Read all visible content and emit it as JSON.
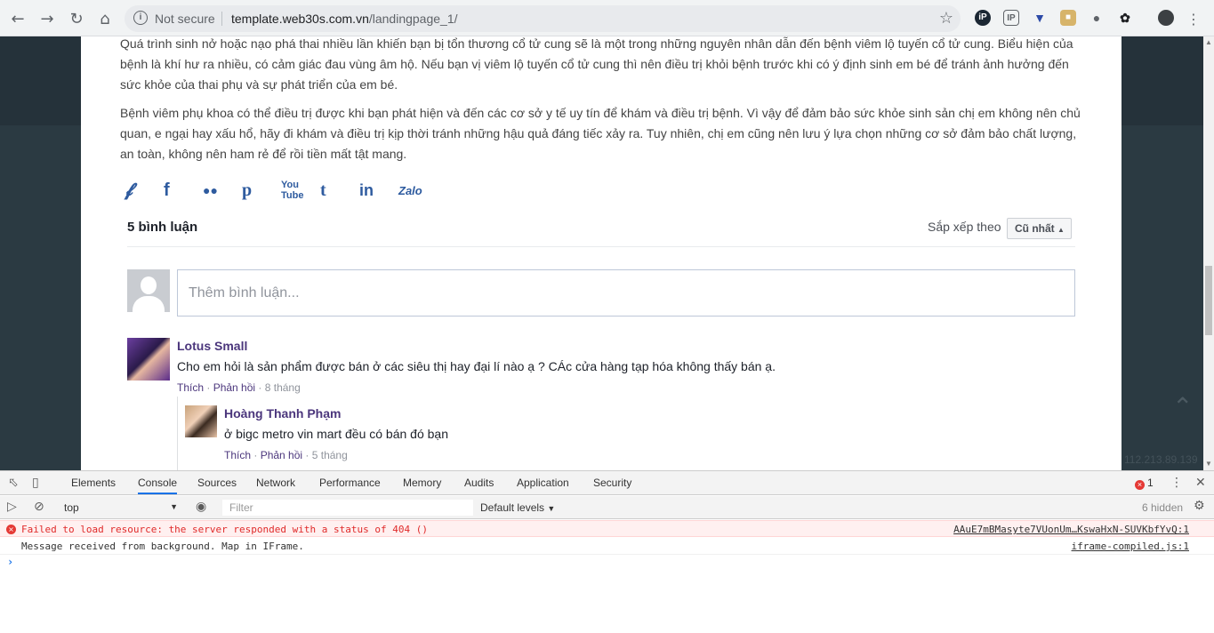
{
  "browser": {
    "security_label": "Not secure",
    "url_host": "template.web30s.com.vn",
    "url_path": "/landingpage_1/"
  },
  "article": {
    "paragraph1": "Quá trình sinh nở hoặc nạo phá thai nhiều lần khiến bạn bị tổn thương cổ tử cung sẽ là một trong những nguyên nhân dẫn đến bệnh viêm lộ tuyến cổ tử cung. Biểu hiện của bệnh là khí hư ra nhiều, có cảm giác đau vùng âm hộ. Nếu bạn vị viêm lộ tuyến cổ tử cung thì nên điều trị khỏi bệnh trước khi có ý định sinh em bé để tránh ảnh hưởng đến sức khỏe của thai phụ và sự phát triển của em bé.",
    "paragraph2": "Bệnh viêm phụ khoa có thể điều trị được khi bạn phát hiện và đến các cơ sở y tế uy tín để khám và điều trị bệnh. Vì vậy để đảm bảo sức khỏe sinh sản chị em không nên chủ quan, e ngại hay xấu hổ, hãy đi khám và điều trị kịp thời tránh những hậu quả đáng tiếc xảy ra. Tuy nhiên, chị em cũng nên lưu ý lựa chọn những cơ sở đảm bảo chất lượng, an toàn, không nên ham rẻ để rồi tiền mất tật mang."
  },
  "social": {
    "zalo_label": "Zalo"
  },
  "comments": {
    "count_label": "5 bình luận",
    "sort_label": "Sắp xếp theo",
    "sort_value": "Cũ nhất",
    "input_placeholder": "Thêm bình luận...",
    "items": [
      {
        "author": "Lotus Small",
        "text": "Cho em hỏi là sản phẩm được bán ở các siêu thị hay đại lí nào ạ ? CÁc cửa hàng tạp hóa không thấy bán ạ.",
        "like": "Thích",
        "reply": "Phản hồi",
        "time": "8 tháng"
      },
      {
        "author": "Hoàng Thanh Phạm",
        "text": "ở bigc metro vin mart đều có bán đó bạn",
        "like": "Thích",
        "reply": "Phản hồi",
        "time": "5 tháng"
      }
    ]
  },
  "page_extra": {
    "ip_text": "112.213.89.139"
  },
  "devtools": {
    "tabs": [
      "Elements",
      "Console",
      "Sources",
      "Network",
      "Performance",
      "Memory",
      "Audits",
      "Application",
      "Security"
    ],
    "error_count": "1",
    "context": "top",
    "filter_placeholder": "Filter",
    "levels": "Default levels",
    "hidden": "6 hidden",
    "messages": [
      {
        "level": "error",
        "text": "Failed to load resource: the server responded with a status of 404 ()",
        "source": "AAuE7mBMasyte7VUonUm…KswaHxN-SUVKbfYvQ:1"
      },
      {
        "level": "info",
        "text": "Message received from background. Map in IFrame.",
        "source": "iframe-compiled.js:1"
      }
    ]
  }
}
